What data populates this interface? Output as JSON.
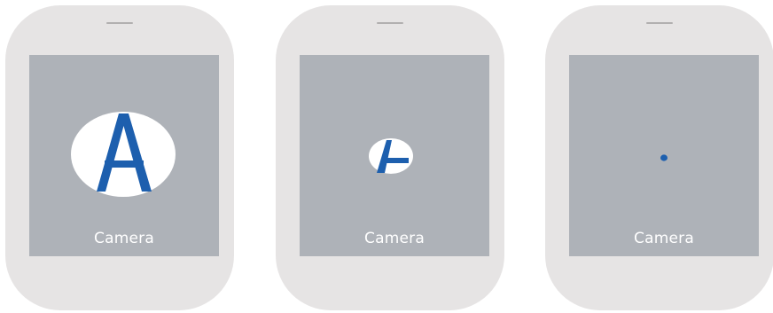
{
  "screens": [
    {
      "app_label": "Camera",
      "icon": "camera-app-icon-full"
    },
    {
      "app_label": "Camera",
      "icon": "camera-app-icon-shrinking"
    },
    {
      "app_label": "Camera",
      "icon": "camera-app-icon-dot"
    }
  ],
  "colors": {
    "device_body": "#e6e4e4",
    "screen": "#aeb2b8",
    "icon_fill": "#ffffff",
    "icon_accent": "#1d5fae",
    "label_text": "#ffffff"
  }
}
